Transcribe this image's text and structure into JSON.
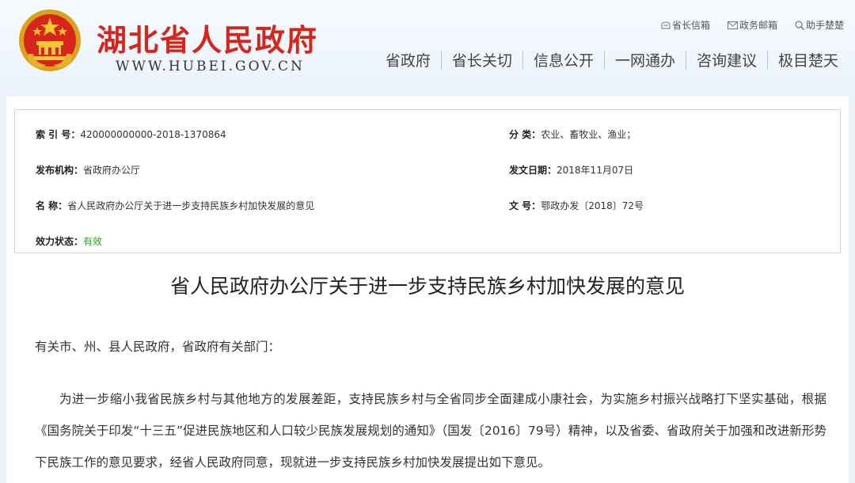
{
  "header": {
    "site_title": "湖北省人民政府",
    "site_url": "WWW.HUBEI.GOV.CN",
    "top_links": [
      "省长信箱",
      "政务邮箱",
      "助手楚楚"
    ],
    "nav": [
      "省政府",
      "省长关切",
      "信息公开",
      "一网通办",
      "咨询建议",
      "极目楚天"
    ]
  },
  "meta": {
    "index_label": "索 引 号：",
    "index_value": "420000000000-2018-1370864",
    "category_label": "分 类：",
    "category_value": "农业、畜牧业、渔业；",
    "publisher_label": "发布机构：",
    "publisher_value": "省政府办公厅",
    "date_label": "发文日期：",
    "date_value": "2018年11月07日",
    "name_label": "名 称：",
    "name_value": "省人民政府办公厅关于进一步支持民族乡村加快发展的意见",
    "docno_label": "文 号：",
    "docno_value": "鄂政办发〔2018〕72号",
    "status_label": "效力状态：",
    "status_value": "有效"
  },
  "document": {
    "title": "省人民政府办公厅关于进一步支持民族乡村加快发展的意见",
    "salutation": "有关市、州、县人民政府，省政府有关部门：",
    "paragraph": "为进一步缩小我省民族乡村与其他地方的发展差距，支持民族乡村与全省同步全面建成小康社会，为实施乡村振兴战略打下坚实基础，根据《国务院关于印发“十三五”促进民族地区和人口较少民族发展规划的通知》（国发〔2016〕79号）精神，以及省委、省政府关于加强和改进新形势下民族工作的意见要求，经省人民政府同意，现就进一步支持民族乡村加快发展提出如下意见。"
  },
  "colors": {
    "brand_red": "#d6261c",
    "status_green": "#2aa12a"
  }
}
